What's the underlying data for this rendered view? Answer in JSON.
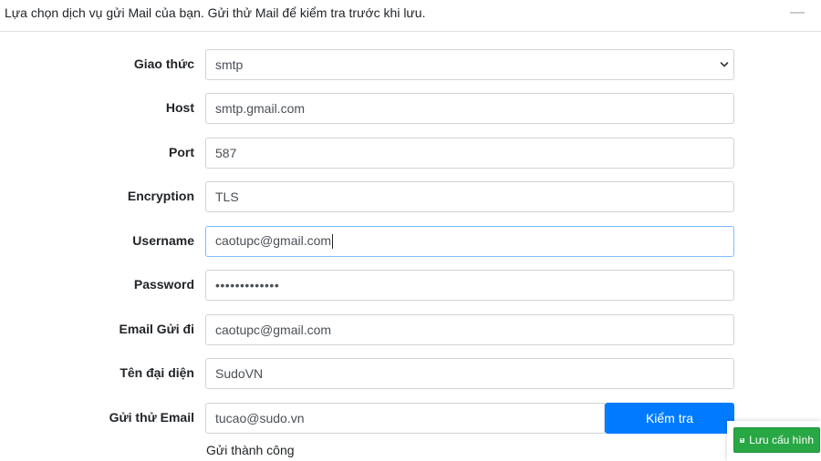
{
  "header": {
    "text": "Lựa chọn dịch vụ gửi Mail của bạn. Gửi thử Mail để kiểm tra trước khi lưu.",
    "collapse_symbol": "—"
  },
  "form": {
    "protocol": {
      "label": "Giao thức",
      "value": "smtp",
      "options": [
        "smtp"
      ]
    },
    "host": {
      "label": "Host",
      "value": "smtp.gmail.com"
    },
    "port": {
      "label": "Port",
      "value": "587"
    },
    "encryption": {
      "label": "Encryption",
      "value": "TLS"
    },
    "username": {
      "label": "Username",
      "value": "caotupc@gmail.com"
    },
    "password": {
      "label": "Password",
      "value": "•••••••••••••"
    },
    "from_email": {
      "label": "Email Gửi đi",
      "value": "caotupc@gmail.com"
    },
    "display_name": {
      "label": "Tên đại diện",
      "value": "SudoVN"
    },
    "test_email": {
      "label": "Gửi thử Email",
      "value": "tucao@sudo.vn",
      "button_label": "Kiểm tra"
    }
  },
  "status": {
    "text": "Gửi thành công"
  },
  "save_button": {
    "label": "Lưu cấu hình",
    "icon": "save-icon"
  },
  "colors": {
    "primary": "#007bff",
    "success": "#28a745",
    "focus_border": "#80bdff"
  }
}
